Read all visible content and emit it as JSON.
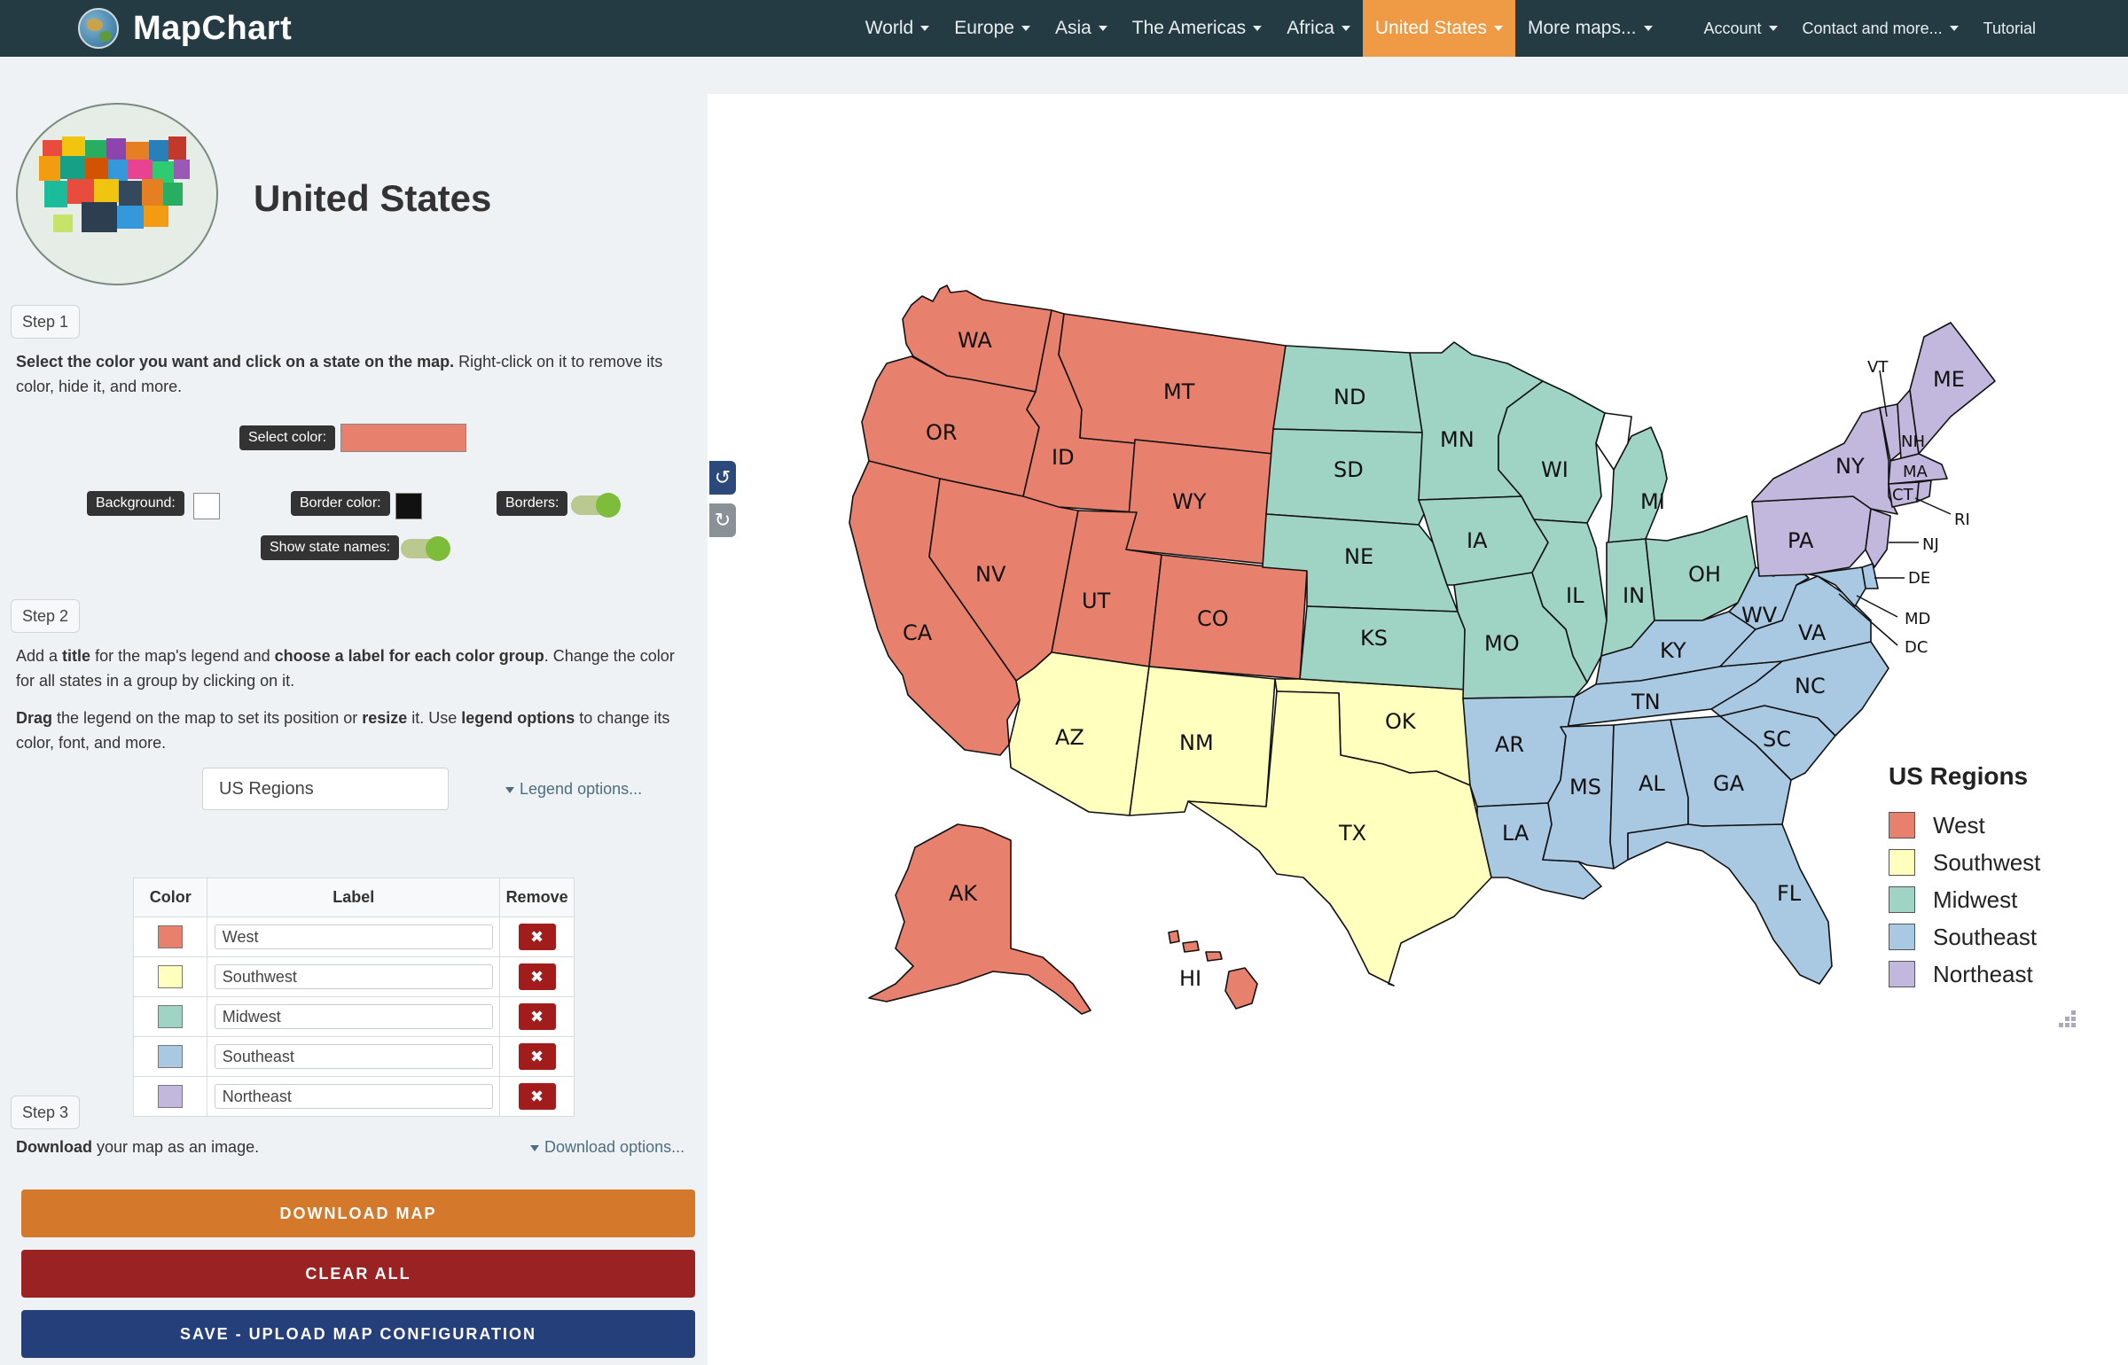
{
  "brand": {
    "name": "MapChart"
  },
  "nav": {
    "items": [
      {
        "label": "World"
      },
      {
        "label": "Europe"
      },
      {
        "label": "Asia"
      },
      {
        "label": "The Americas"
      },
      {
        "label": "Africa"
      },
      {
        "label": "United States",
        "active": true
      },
      {
        "label": "More maps..."
      }
    ],
    "right_items": [
      {
        "label": "Account"
      },
      {
        "label": "Contact and more..."
      },
      {
        "label": "Tutorial"
      }
    ]
  },
  "page": {
    "title": "United States"
  },
  "step1": {
    "badge": "Step 1",
    "text_bold": "Select the color you want and click on a state on the map.",
    "text_rest": " Right-click on it to remove its color, hide it, and more.",
    "select_color_label": "Select color:",
    "selected_color": "#e8806e",
    "background_label": "Background:",
    "background_color": "#ffffff",
    "border_color_label": "Border color:",
    "border_color": "#111111",
    "borders_label": "Borders:",
    "show_names_label": "Show state names:"
  },
  "step2": {
    "badge": "Step 2",
    "p1_a": "Add a ",
    "p1_b": "title",
    "p1_c": " for the map's legend and ",
    "p1_d": "choose a label for each color group",
    "p1_e": ". Change the color for all states in a group by clicking on it.",
    "p2_a": "Drag",
    "p2_b": " the legend on the map to set its position or ",
    "p2_c": "resize",
    "p2_d": " it. Use ",
    "p2_e": "legend options",
    "p2_f": " to change its color, font, and more.",
    "legend_title_value": "US Regions",
    "legend_options_link": "Legend options...",
    "table_headers": {
      "color": "Color",
      "label": "Label",
      "remove": "Remove"
    },
    "groups": [
      {
        "label": "West",
        "color": "#e8806e"
      },
      {
        "label": "Southwest",
        "color": "#ffffbe"
      },
      {
        "label": "Midwest",
        "color": "#9fd3c4"
      },
      {
        "label": "Southeast",
        "color": "#a9c8e2"
      },
      {
        "label": "Northeast",
        "color": "#c2b7dc"
      }
    ],
    "remove_glyph": "✖"
  },
  "step3": {
    "badge": "Step 3",
    "text_bold": "Download",
    "text_rest": " your map as an image.",
    "download_options_link": "Download options...",
    "download_btn": "DOWNLOAD MAP",
    "clear_btn": "CLEAR ALL",
    "save_btn": "SAVE - UPLOAD MAP CONFIGURATION"
  },
  "map": {
    "legend_title": "US Regions",
    "legend_items": [
      "West",
      "Southwest",
      "Midwest",
      "Southeast",
      "Northeast"
    ],
    "state_labels": [
      "WA",
      "OR",
      "CA",
      "ID",
      "NV",
      "MT",
      "WY",
      "UT",
      "CO",
      "AZ",
      "NM",
      "TX",
      "OK",
      "ND",
      "SD",
      "NE",
      "KS",
      "MN",
      "IA",
      "MO",
      "WI",
      "IL",
      "MI",
      "IN",
      "OH",
      "KY",
      "TN",
      "AR",
      "LA",
      "MS",
      "AL",
      "GA",
      "FL",
      "SC",
      "NC",
      "VA",
      "WV",
      "PA",
      "NY",
      "ME",
      "VT",
      "NH",
      "MA",
      "CT",
      "RI",
      "NJ",
      "DE",
      "MD",
      "DC",
      "AK",
      "HI"
    ]
  },
  "icons": {
    "undo": "undo-icon",
    "redo": "redo-icon",
    "resize": "resize-grip-icon"
  }
}
